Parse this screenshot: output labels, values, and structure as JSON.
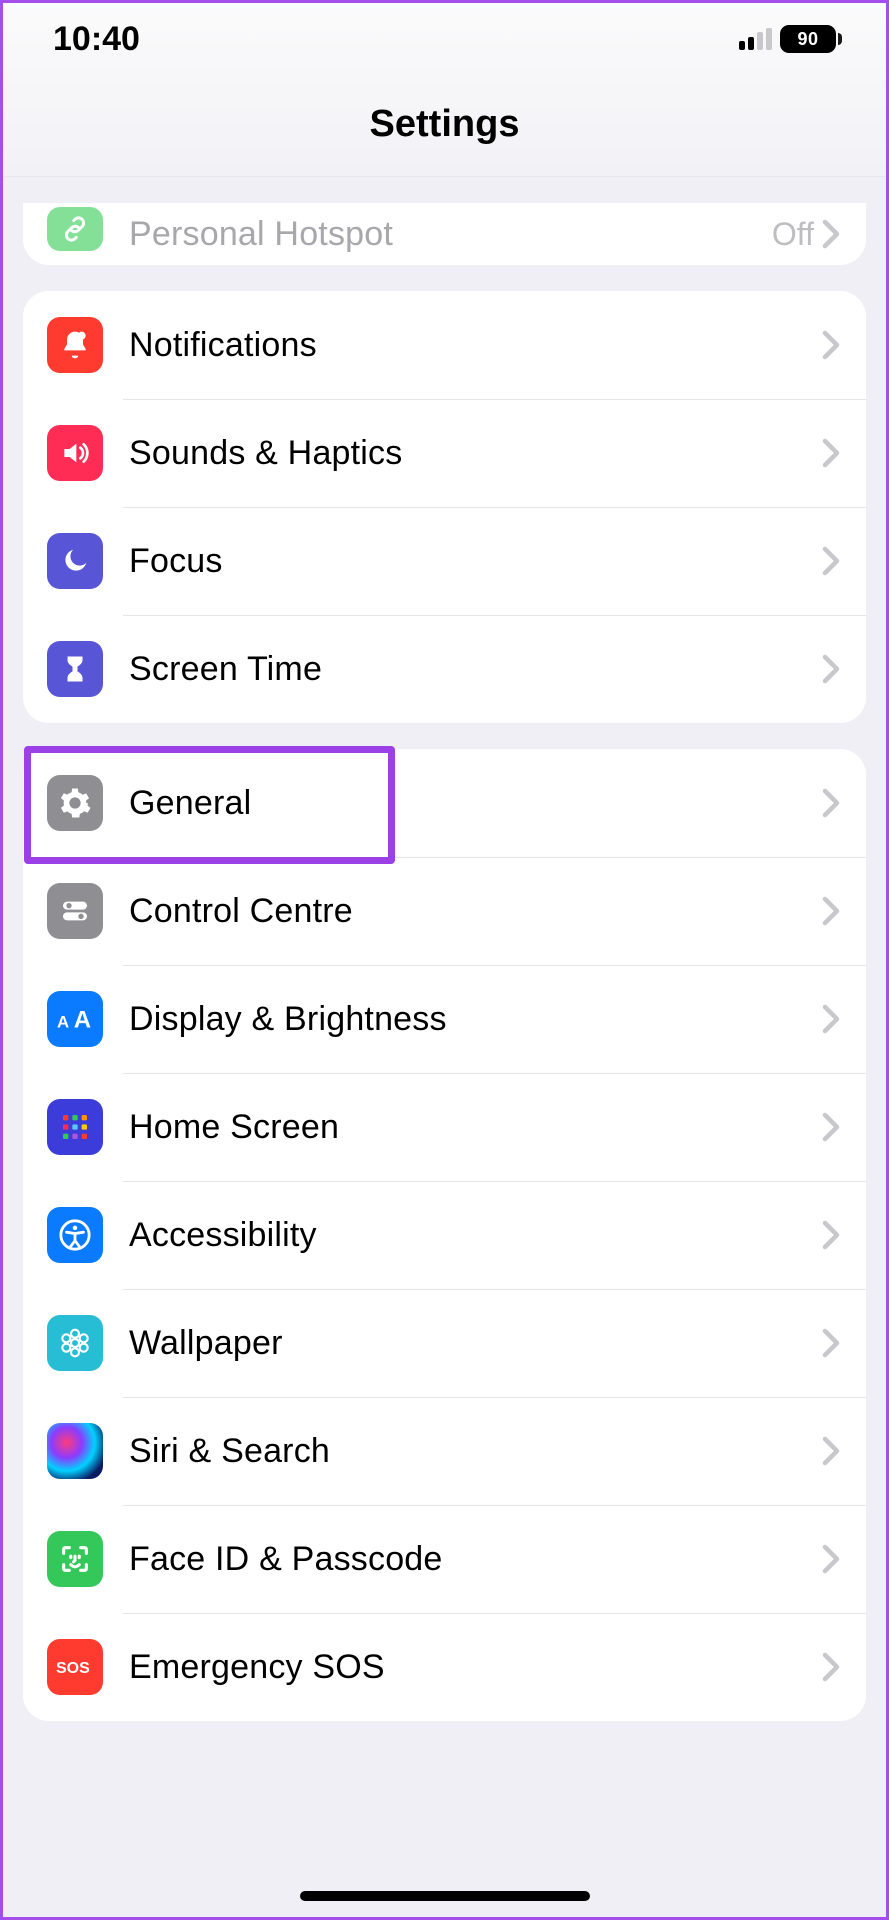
{
  "status": {
    "time": "10:40",
    "battery": "90"
  },
  "nav": {
    "title": "Settings"
  },
  "groups": [
    {
      "partial": true,
      "items": [
        {
          "key": "personal-hotspot",
          "label": "Personal Hotspot",
          "value": "Off",
          "icon": "link-icon",
          "bg": "#5BD674",
          "dim": true
        }
      ]
    },
    {
      "items": [
        {
          "key": "notifications",
          "label": "Notifications",
          "icon": "bell-icon",
          "bg": "#FF3B30"
        },
        {
          "key": "sounds-haptics",
          "label": "Sounds & Haptics",
          "icon": "speaker-icon",
          "bg": "#FF2D55"
        },
        {
          "key": "focus",
          "label": "Focus",
          "icon": "moon-icon",
          "bg": "#5856D6"
        },
        {
          "key": "screen-time",
          "label": "Screen Time",
          "icon": "hourglass-icon",
          "bg": "#5856D6"
        }
      ]
    },
    {
      "items": [
        {
          "key": "general",
          "label": "General",
          "icon": "gear-icon",
          "bg": "#8E8E93",
          "highlight": true
        },
        {
          "key": "control-centre",
          "label": "Control Centre",
          "icon": "switches-icon",
          "bg": "#8E8E93"
        },
        {
          "key": "display-brightness",
          "label": "Display & Brightness",
          "icon": "aa-icon",
          "bg": "#0A7AFF"
        },
        {
          "key": "home-screen",
          "label": "Home Screen",
          "icon": "apps-grid-icon",
          "bg": "#3C3CDB"
        },
        {
          "key": "accessibility",
          "label": "Accessibility",
          "icon": "accessibility-icon",
          "bg": "#0A7AFF"
        },
        {
          "key": "wallpaper",
          "label": "Wallpaper",
          "icon": "flower-icon",
          "bg": "#27BDD4"
        },
        {
          "key": "siri-search",
          "label": "Siri & Search",
          "icon": "siri-icon",
          "bg": "siri"
        },
        {
          "key": "face-id-passcode",
          "label": "Face ID & Passcode",
          "icon": "face-id-icon",
          "bg": "#34C759"
        },
        {
          "key": "emergency-sos",
          "label": "Emergency SOS",
          "icon": "sos-icon",
          "bg": "#FF3B30"
        }
      ]
    }
  ],
  "annotation": {
    "highlight_color": "#9B40E6"
  }
}
